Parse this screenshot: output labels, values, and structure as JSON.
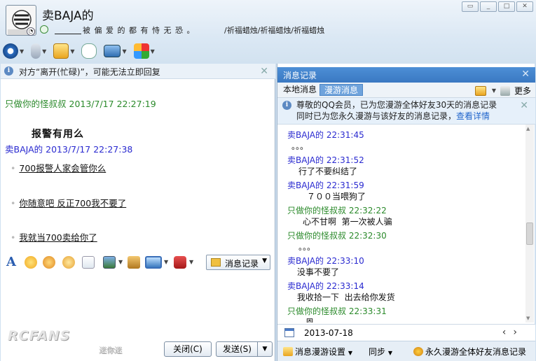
{
  "header": {
    "contact_name": "卖BAJA的",
    "signature": "被 偏 爱 的 都 有 恃 无 恐 。",
    "topic": "/祈福蜡烛/祈福蜡烛/祈福蜡烛"
  },
  "left": {
    "notice": "对方“离开(忙碌)”，可能无法立即回复",
    "messages": [
      {
        "sender": "只做你的怪叔叔",
        "time": "2013/7/17 22:27:19",
        "text": "报警有用么"
      },
      {
        "sender": "卖BAJA的",
        "time": "2013/7/17 22:27:38"
      }
    ],
    "bullets": [
      "700报警人家会管你么",
      "你随意吧 反正700我不要了",
      "我就当700卖给你了"
    ],
    "history_button": "消息记录",
    "close_button": "关闭(C)",
    "send_button": "发送(S)",
    "logo": "RCFANS",
    "logo_sub": "迷你迷"
  },
  "right": {
    "title": "消息记录",
    "tabs": [
      "本地消息",
      "漫游消息"
    ],
    "more_label": "更多",
    "vip_line1": "尊敬的QQ会员，已为您漫游全体好友30天的消息记录",
    "vip_line2": "同时已为您永久漫游与该好友的消息记录，",
    "vip_link": "查看详情",
    "log": [
      {
        "sender": "卖BAJA的",
        "time": "22:31:45",
        "text": "。。。",
        "color": "blue"
      },
      {
        "sender": "卖BAJA的",
        "time": "22:31:52",
        "text": "行了不要纠结了",
        "color": "blue"
      },
      {
        "sender": "卖BAJA的",
        "time": "22:31:59",
        "text": "７００当喂狗了",
        "color": "blue"
      },
      {
        "sender": "只做你的怪叔叔",
        "time": "22:32:22",
        "text": "心不甘啊  第一次被人骗",
        "color": "green"
      },
      {
        "sender": "只做你的怪叔叔",
        "time": "22:32:30",
        "text": "。。。",
        "color": "green"
      },
      {
        "sender": "卖BAJA的",
        "time": "22:33:10",
        "text": "没事不要了",
        "color": "blue"
      },
      {
        "sender": "卖BAJA的",
        "time": "22:33:14",
        "text": "我收拾一下  出去给你发货",
        "color": "blue"
      },
      {
        "sender": "只做你的怪叔叔",
        "time": "22:33:31",
        "text": "恩",
        "color": "green"
      }
    ],
    "date": "2013-07-18",
    "bottom": {
      "settings": "消息漫游设置",
      "sync": "同步",
      "permanent": "永久漫游全体好友消息记录"
    }
  },
  "colors": {
    "green_sender": "#2b8a2b",
    "blue_sender": "#2a2ad0",
    "header_blue": "#3a78c2"
  }
}
